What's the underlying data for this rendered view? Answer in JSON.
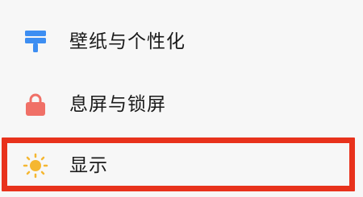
{
  "settings": {
    "items": [
      {
        "label": "壁纸与个性化",
        "icon": "wallpaper-brush-icon",
        "color": "#3d8ef2"
      },
      {
        "label": "息屏与锁屏",
        "icon": "lock-icon",
        "color": "#f07067"
      },
      {
        "label": "显示",
        "icon": "sun-icon",
        "color": "#f5b731"
      }
    ],
    "highlight_color": "#e8321c"
  }
}
